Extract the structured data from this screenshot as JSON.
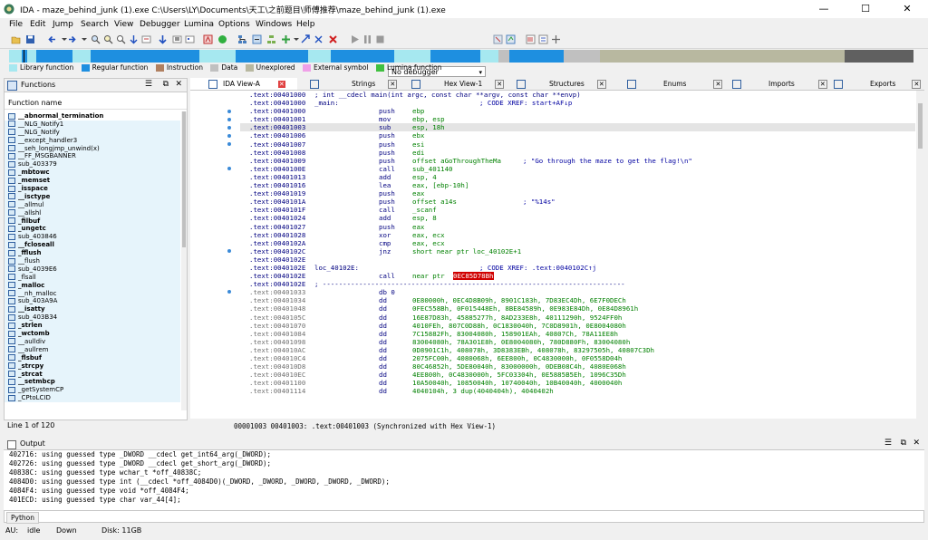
{
  "window": {
    "title": "IDA - maze_behind_junk (1).exe C:\\Users\\LY\\Documents\\天工\\之前题目\\师傅推荐\\maze_behind_junk (1).exe",
    "minimize": "—",
    "maximize": "☐",
    "close": "✕"
  },
  "menu": [
    "File",
    "Edit",
    "Jump",
    "Search",
    "View",
    "Debugger",
    "Lumina",
    "Options",
    "Windows",
    "Help"
  ],
  "toolbar": {
    "debugger_select": "No debugger"
  },
  "legend": [
    {
      "label": "Library function",
      "color": "#a6e8f0"
    },
    {
      "label": "Regular function",
      "color": "#1e8fe0"
    },
    {
      "label": "Instruction",
      "color": "#b08060"
    },
    {
      "label": "Data",
      "color": "#c0c0c0"
    },
    {
      "label": "Unexplored",
      "color": "#b8b8a0"
    },
    {
      "label": "External symbol",
      "color": "#f0a0e8"
    },
    {
      "label": "Lumina function",
      "color": "#40c040"
    }
  ],
  "functions_panel": {
    "title": "Functions",
    "column": "Function name",
    "items": [
      "__abnormal_termination",
      "__NLG_Notify1",
      "__NLG_Notify",
      "__except_handler3",
      "__seh_longjmp_unwind(x)",
      "__FF_MSGBANNER",
      "sub_403379",
      "_mbtowc",
      "_memset",
      "_isspace",
      "__isctype",
      "__allmul",
      "__allshl",
      "_filbuf",
      "_ungetc",
      "sub_403846",
      "__fcloseall",
      "_fflush",
      "__flush",
      "sub_4039E6",
      "_flsall",
      "_malloc",
      "__nh_malloc",
      "sub_403A9A",
      "__isatty",
      "sub_403B34",
      "_strlen",
      "_wctomb",
      "__aulldiv",
      "__aullrem",
      "_flsbuf",
      "_strcpy",
      "_strcat",
      "__setmbcp",
      "_getSystemCP",
      "_CPtoLCID"
    ],
    "bold_items": [
      "__abnormal_termination",
      "_mbtowc",
      "_memset",
      "_isspace",
      "__isctype",
      "_filbuf",
      "_ungetc",
      "__fcloseall",
      "_fflush",
      "_malloc",
      "__isatty",
      "_strlen",
      "_wctomb",
      "_flsbuf",
      "_strcpy",
      "_strcat",
      "__setmbcp"
    ],
    "line_count": "Line 1 of 120"
  },
  "tabs": [
    {
      "label": "IDA View-A",
      "active": true
    },
    {
      "label": "Strings"
    },
    {
      "label": "Hex View-1"
    },
    {
      "label": "Structures"
    },
    {
      "label": "Enums"
    },
    {
      "label": "Imports"
    },
    {
      "label": "Exports"
    }
  ],
  "code": [
    {
      "addr": ".text:00401000",
      "label": "; int __cdecl main(int argc, const char **argv, const char **envp)",
      "op": "",
      "arg": "",
      "cmt": ""
    },
    {
      "addr": ".text:00401000",
      "label": "_main:",
      "op": "",
      "arg": "",
      "cmt": "; CODE XREF: start+AF↓p"
    },
    {
      "addr": ".text:00401000",
      "label": "",
      "op": "push",
      "arg": "ebp",
      "cmt": ""
    },
    {
      "addr": ".text:00401001",
      "label": "",
      "op": "mov",
      "arg": "ebp, esp",
      "cmt": ""
    },
    {
      "addr": ".text:00401003",
      "label": "",
      "op": "sub",
      "arg": "esp, 18h",
      "cmt": "",
      "hl": true
    },
    {
      "addr": ".text:00401006",
      "label": "",
      "op": "push",
      "arg": "ebx",
      "cmt": ""
    },
    {
      "addr": ".text:00401007",
      "label": "",
      "op": "push",
      "arg": "esi",
      "cmt": ""
    },
    {
      "addr": ".text:00401008",
      "label": "",
      "op": "push",
      "arg": "edi",
      "cmt": ""
    },
    {
      "addr": ".text:00401009",
      "label": "",
      "op": "push",
      "arg": "offset aGoThroughTheMa",
      "cmt": "; \"Go through the maze to get the flag!\\n\""
    },
    {
      "addr": ".text:0040100E",
      "label": "",
      "op": "call",
      "arg": "sub_401140",
      "cmt": ""
    },
    {
      "addr": ".text:00401013",
      "label": "",
      "op": "add",
      "arg": "esp, 4",
      "cmt": ""
    },
    {
      "addr": ".text:00401016",
      "label": "",
      "op": "lea",
      "arg": "eax, [ebp-10h]",
      "cmt": ""
    },
    {
      "addr": ".text:00401019",
      "label": "",
      "op": "push",
      "arg": "eax",
      "cmt": ""
    },
    {
      "addr": ".text:0040101A",
      "label": "",
      "op": "push",
      "arg": "offset a14s",
      "cmt": "; \"%14s\""
    },
    {
      "addr": ".text:0040101F",
      "label": "",
      "op": "call",
      "arg": "_scanf",
      "cmt": ""
    },
    {
      "addr": ".text:00401024",
      "label": "",
      "op": "add",
      "arg": "esp, 8",
      "cmt": ""
    },
    {
      "addr": ".text:00401027",
      "label": "",
      "op": "push",
      "arg": "eax",
      "cmt": ""
    },
    {
      "addr": ".text:00401028",
      "label": "",
      "op": "xor",
      "arg": "eax, ecx",
      "cmt": ""
    },
    {
      "addr": ".text:0040102A",
      "label": "",
      "op": "cmp",
      "arg": "eax, ecx",
      "cmt": ""
    },
    {
      "addr": ".text:0040102C",
      "label": "",
      "op": "jnz",
      "arg": "short near ptr loc_40102E+1",
      "cmt": ""
    },
    {
      "addr": ".text:0040102E",
      "label": "",
      "op": "",
      "arg": "",
      "cmt": ""
    },
    {
      "addr": ".text:0040102E",
      "label": "loc_40102E:",
      "op": "",
      "arg": "",
      "cmt": "; CODE XREF: .text:0040102C↑j"
    },
    {
      "addr": ".text:0040102E",
      "label": "",
      "op": "call",
      "arg": "near ptr ",
      "cmt": "",
      "badref": "0EC85D78Bh"
    },
    {
      "addr": ".text:0040102E",
      "label": "; ---------------------------------------------------------------------------",
      "op": "",
      "arg": "",
      "cmt": ""
    },
    {
      "addr": ".text:00401033",
      "label": "",
      "op": "db 0",
      "arg": "",
      "cmt": "",
      "grey": true
    },
    {
      "addr": ".text:00401034",
      "label": "",
      "op": "dd",
      "arg": "0E80000h, 0EC4D8B09h, 8901C183h, 7D83EC4Dh, 6E7F0DECh",
      "cmt": "",
      "grey": true
    },
    {
      "addr": ".text:00401048",
      "label": "",
      "op": "dd",
      "arg": "0FEC558Bh, 0F015448Eh, 8BE84589h, 0E983E84Dh, 0E84D8961h",
      "cmt": "",
      "grey": true
    },
    {
      "addr": ".text:0040105C",
      "label": "",
      "op": "dd",
      "arg": "16E87D83h, 45885277h, 8AD233E8h, 40111290h, 9524FF0h",
      "cmt": "",
      "grey": true
    },
    {
      "addr": ".text:00401070",
      "label": "",
      "op": "dd",
      "arg": "4010FEh, 807C0D88h, 0C1830040h, 7C0D8901h, 0E8004080h",
      "cmt": "",
      "grey": true
    },
    {
      "addr": ".text:00401084",
      "label": "",
      "op": "dd",
      "arg": "7C15882Fh, 83004080h, 158901EAh, 40807Ch, 78A11EE8h",
      "cmt": "",
      "grey": true
    },
    {
      "addr": ".text:00401098",
      "label": "",
      "op": "dd",
      "arg": "83004080h, 78A301E8h, 0E8004080h, 780D880Fh, 83004080h",
      "cmt": "",
      "grey": true
    },
    {
      "addr": ".text:004010AC",
      "label": "",
      "op": "dd",
      "arg": "0D8901C1h, 408078h, 3D8383EBh, 408078h, 83297505h, 40807C3Dh",
      "cmt": "",
      "grey": true
    },
    {
      "addr": ".text:004010C4",
      "label": "",
      "op": "dd",
      "arg": "2075FC00h, 4080068h, 6EE800h, 0C4830000h, 0F0558D04h",
      "cmt": "",
      "grey": true
    },
    {
      "addr": ".text:004010D8",
      "label": "",
      "op": "dd",
      "arg": "80C46852h, 5DE80040h, 83000000h, 0DEB08C4h, 4080E068h",
      "cmt": "",
      "grey": true
    },
    {
      "addr": ".text:004010EC",
      "label": "",
      "op": "dd",
      "arg": "4EE800h, 0C4830000h, 5FC03304h, 0E5885B5Eh, 1096C35Dh",
      "cmt": "",
      "grey": true
    },
    {
      "addr": ".text:00401100",
      "label": "",
      "op": "dd",
      "arg": "10A50040h, 10850040h, 10740040h, 10B40040h, 4000040h",
      "cmt": "",
      "grey": true
    },
    {
      "addr": ".text:00401114",
      "label": "",
      "op": "dd",
      "arg": "4040104h, 3 dup(4040404h), 4040402h",
      "cmt": "",
      "grey": true
    }
  ],
  "sync_status": "00001003 00401003: .text:00401003 (Synchronized with Hex View-1)",
  "output": {
    "title": "Output",
    "lines": [
      "402716: using guessed type _DWORD __cdecl get_int64_arg(_DWORD);",
      "402726: using guessed type _DWORD __cdecl get_short_arg(_DWORD);",
      "40838C: using guessed type wchar_t *off_40838C;",
      "4084D0: using guessed type int (__cdecl *off_4084D0)(_DWORD, _DWORD, _DWORD, _DWORD, _DWORD);",
      "4084F4: using guessed type void *off_4084F4;",
      "401ECD: using guessed type char var_44[4];"
    ],
    "python_btn": "Python"
  },
  "statusbar": {
    "au": "AU:",
    "state": "idle",
    "dir": "Down",
    "disk": "Disk: 11GB"
  }
}
